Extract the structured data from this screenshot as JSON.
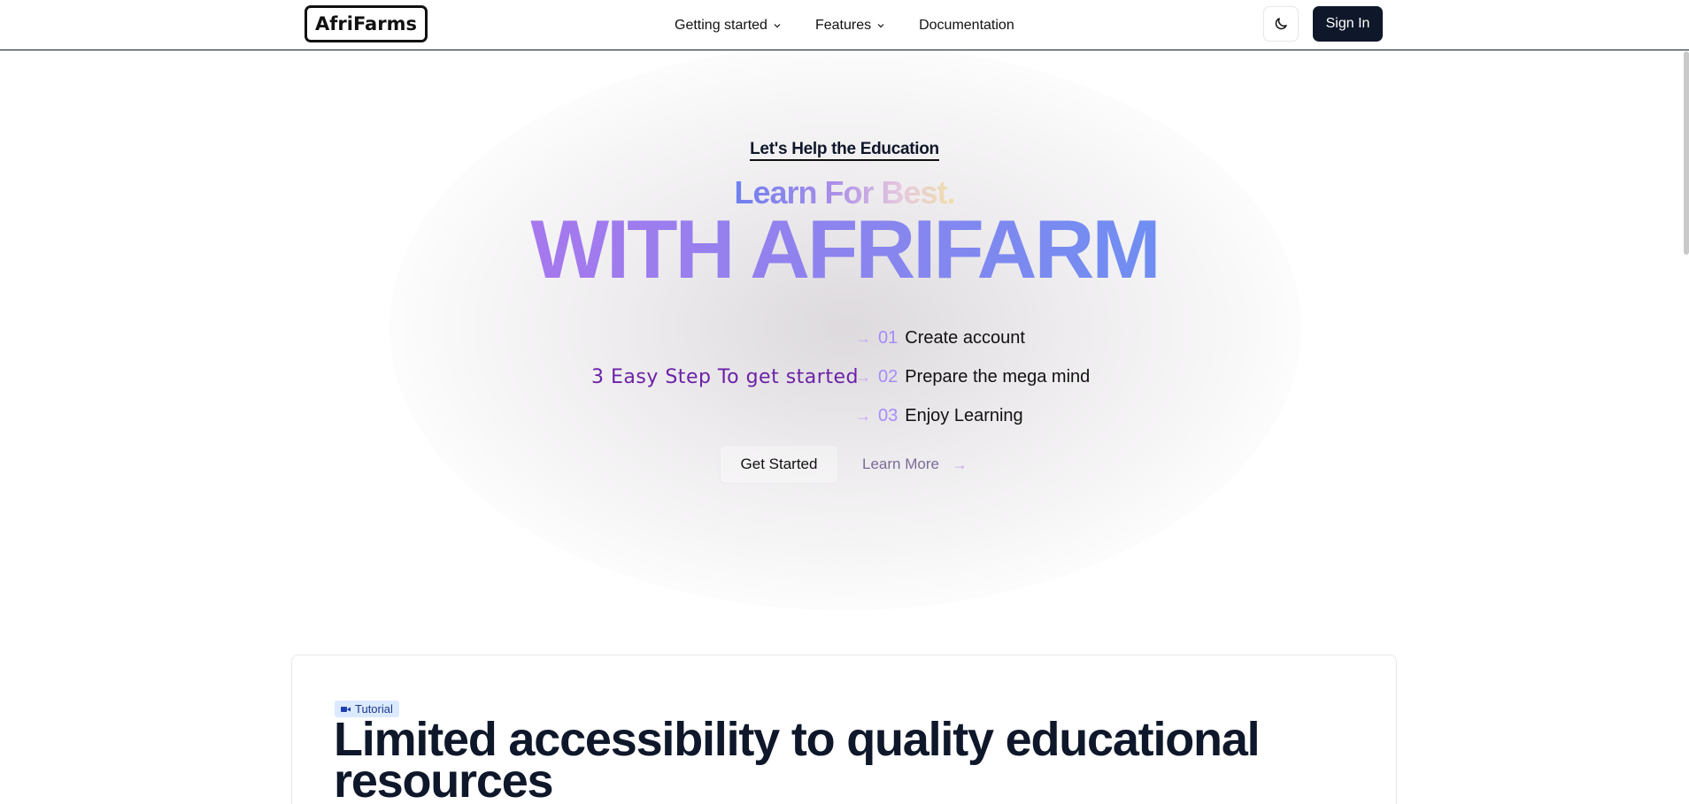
{
  "header": {
    "logo": "AfriFarms",
    "nav": [
      {
        "label": "Getting started",
        "has_menu": true
      },
      {
        "label": "Features",
        "has_menu": true
      },
      {
        "label": "Documentation",
        "has_menu": false
      }
    ],
    "theme_icon": "moon-icon",
    "sign_in": "Sign In"
  },
  "hero": {
    "eyebrow": "Let's Help the Education",
    "subtitle": "Learn For Best.",
    "title": "WITH AFRIFARM",
    "steps_label": "3 Easy Step To get started",
    "steps": [
      {
        "num": "01",
        "text": "Create account"
      },
      {
        "num": "02",
        "text": "Prepare the mega mind"
      },
      {
        "num": "03",
        "text": "Enjoy Learning"
      }
    ],
    "primary_button": "Get Started",
    "secondary_button": "Learn More"
  },
  "card": {
    "badge": "Tutorial",
    "badge_icon": "video-icon",
    "title": "Limited accessibility to quality educational resources"
  },
  "colors": {
    "accent_dark": "#0f172a",
    "purple": "#6b21a8",
    "step_num": "#a78bfa"
  }
}
